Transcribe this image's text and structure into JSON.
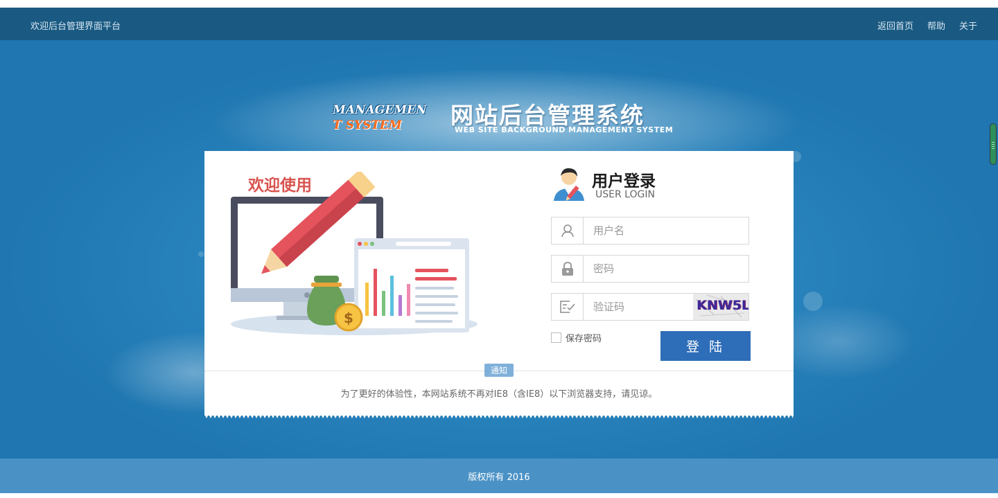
{
  "header": {
    "site_title": "欢迎后台管理界面平台",
    "nav": [
      "返回首页",
      "帮助",
      "关于"
    ]
  },
  "logo": {
    "en_line1": "MANAGEMEN",
    "en_line2": "T SYSTEM",
    "cn_title": "网站后台管理系统",
    "subtitle": "WEB SITE BACKGROUND MANAGEMENT SYSTEM"
  },
  "welcome": {
    "text": "欢迎使用"
  },
  "login": {
    "title": "用户登录",
    "subtitle": "USER LOGIN",
    "username_placeholder": "用户名",
    "password_placeholder": "密码",
    "captcha_placeholder": "验证码",
    "captcha_code": "KNW5L",
    "remember_label": "保存密码",
    "submit_label": "登 陆"
  },
  "notice": {
    "badge": "通知",
    "text": "为了更好的体验性，本网站系统不再对IE8（含IE8）以下浏览器支持，请见谅。"
  },
  "footer": {
    "copyright": "版权所有 2016"
  },
  "colors": {
    "topbar": "#1a5a82",
    "background": "#1f76b0",
    "button": "#2e6db8",
    "welcome_red": "#d9544f",
    "footer": "#4a92c6"
  },
  "icons": [
    "user-icon",
    "lock-icon",
    "captcha-check-icon",
    "avatar-icon"
  ]
}
